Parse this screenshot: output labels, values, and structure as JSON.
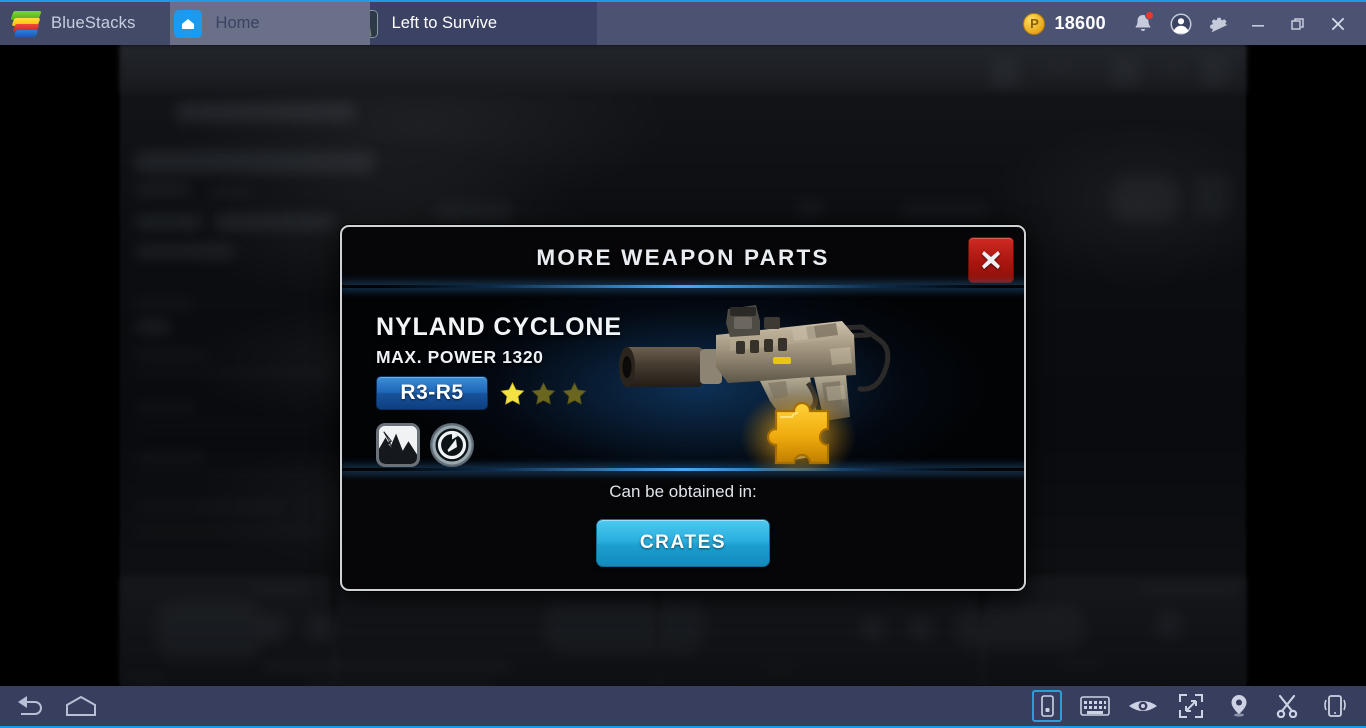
{
  "titlebar": {
    "brand": "BlueStacks",
    "brand_icon": "bluestacks-logo",
    "tabs": [
      {
        "label": "Home",
        "icon": "home-app-icon",
        "active": false
      },
      {
        "label": "Left to Survive",
        "icon": "game-app-icon",
        "active": true
      }
    ],
    "points": {
      "value": "18600",
      "icon": "points-coin-icon",
      "symbol": "P"
    },
    "actions": [
      {
        "name": "notifications-icon",
        "badge": true
      },
      {
        "name": "account-icon",
        "badge": false
      },
      {
        "name": "settings-gear-icon",
        "badge": false
      }
    ],
    "window_controls": [
      {
        "name": "minimize-button",
        "glyph": "—"
      },
      {
        "name": "restore-button",
        "glyph": "❐"
      },
      {
        "name": "close-button",
        "glyph": "✕"
      }
    ]
  },
  "modal": {
    "title": "MORE WEAPON PARTS",
    "close_label": "✕",
    "weapon": {
      "name": "NYLAND CYCLONE",
      "max_power": "MAX. POWER 1320",
      "rank_range": "R3-R5",
      "stars_total": 3,
      "stars_filled": 1,
      "perks": [
        {
          "name": "damage-perk-icon"
        },
        {
          "name": "reload-speed-perk-icon"
        }
      ],
      "art": "nyland-cyclone-smg-with-weapon-part",
      "part_icon": "puzzle-piece-weapon-part"
    },
    "obtained_label": "Can be obtained in:",
    "crates_button": "CRATES"
  },
  "bottombar": {
    "left": [
      {
        "name": "back-button",
        "icon": "back-arrow-icon"
      },
      {
        "name": "home-button",
        "icon": "home-outline-icon"
      }
    ],
    "right": [
      {
        "name": "rotate-screen-button",
        "icon": "phone-rotate-icon"
      },
      {
        "name": "keyboard-controls-button",
        "icon": "keyboard-icon"
      },
      {
        "name": "eye-button",
        "icon": "eye-icon"
      },
      {
        "name": "fullscreen-button",
        "icon": "fullscreen-expand-icon"
      },
      {
        "name": "location-button",
        "icon": "location-pin-icon"
      },
      {
        "name": "cut-button",
        "icon": "scissors-icon"
      },
      {
        "name": "shake-button",
        "icon": "shake-phone-icon"
      }
    ]
  },
  "colors": {
    "titlebar_bg": "#4c5372",
    "accent_blue": "#1e9ae8",
    "tab_active_bg": "#3b4263",
    "tab_inactive_bg": "#6a7088",
    "close_red": "#a9160f",
    "crates_cyan": "#1b9fd0",
    "rank_blue": "#1f66b8",
    "star_filled": "#f0e040",
    "star_empty": "#6a6620",
    "bottombar_bg": "#373e5e",
    "part_gold": "#f0b815"
  }
}
